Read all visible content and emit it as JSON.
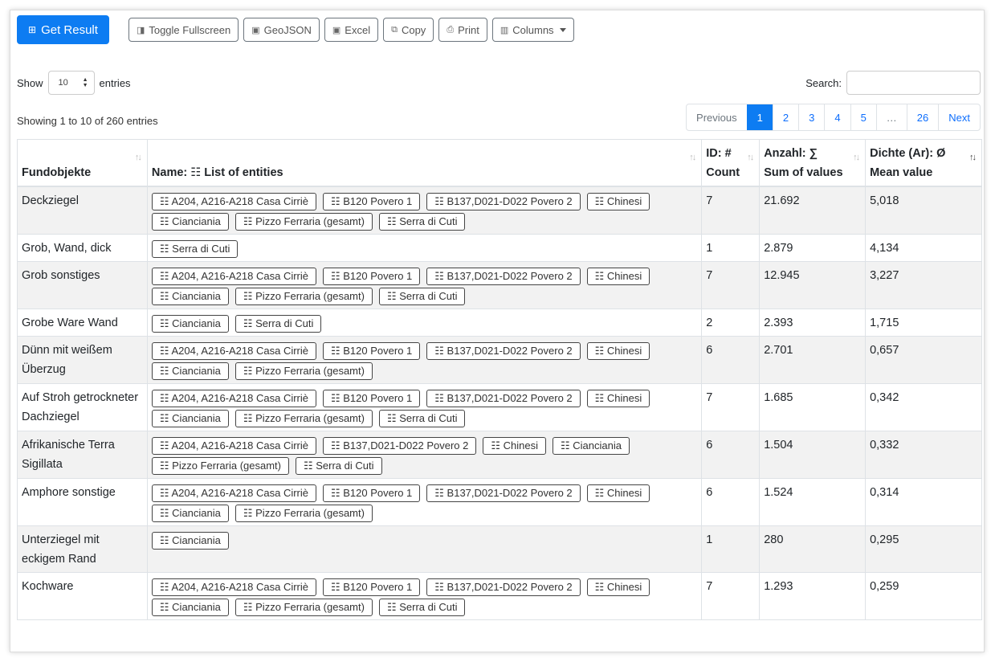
{
  "toolbar": {
    "get_result": "Get Result",
    "toggle_fullscreen": "Toggle Fullscreen",
    "geojson": "GeoJSON",
    "excel": "Excel",
    "copy": "Copy",
    "print": "Print",
    "columns": "Columns"
  },
  "length": {
    "show": "Show",
    "value": "10",
    "entries": "entries"
  },
  "search": {
    "label": "Search:"
  },
  "info": "Showing 1 to 10 of 260 entries",
  "pager": [
    "Previous",
    "1",
    "2",
    "3",
    "4",
    "5",
    "…",
    "26",
    "Next"
  ],
  "columns": {
    "c1": [
      "Fundobjekte"
    ],
    "c2": [
      "Name: ☷ List of entities"
    ],
    "c3": [
      "ID: #",
      "Count"
    ],
    "c4": [
      "Anzahl: ∑",
      "Sum of values"
    ],
    "c5": [
      "Dichte (Ar): Ø",
      "Mean value"
    ]
  },
  "rows": [
    {
      "name": "Deckziegel",
      "entities": [
        "☷ A204, A216-A218 Casa Cirriè",
        "☷ B120 Povero 1",
        "☷ B137,D021-D022 Povero 2",
        "☷ Chinesi",
        "☷ Cianciania",
        "☷ Pizzo Ferraria (gesamt)",
        "☷ Serra di Cuti"
      ],
      "count": "7",
      "sum": "21.692",
      "mean": "5,018"
    },
    {
      "name": "Grob, Wand, dick",
      "entities": [
        "☷ Serra di Cuti"
      ],
      "count": "1",
      "sum": "2.879",
      "mean": "4,134"
    },
    {
      "name": "Grob sonstiges",
      "entities": [
        "☷ A204, A216-A218 Casa Cirriè",
        "☷ B120 Povero 1",
        "☷ B137,D021-D022 Povero 2",
        "☷ Chinesi",
        "☷ Cianciania",
        "☷ Pizzo Ferraria (gesamt)",
        "☷ Serra di Cuti"
      ],
      "count": "7",
      "sum": "12.945",
      "mean": "3,227"
    },
    {
      "name": "Grobe Ware Wand",
      "entities": [
        "☷ Cianciania",
        "☷ Serra di Cuti"
      ],
      "count": "2",
      "sum": "2.393",
      "mean": "1,715"
    },
    {
      "name": "Dünn mit weißem Überzug",
      "entities": [
        "☷ A204, A216-A218 Casa Cirriè",
        "☷ B120 Povero 1",
        "☷ B137,D021-D022 Povero 2",
        "☷ Chinesi",
        "☷ Cianciania",
        "☷ Pizzo Ferraria (gesamt)"
      ],
      "count": "6",
      "sum": "2.701",
      "mean": "0,657"
    },
    {
      "name": "Auf Stroh getrockneter Dachziegel",
      "entities": [
        "☷ A204, A216-A218 Casa Cirriè",
        "☷ B120 Povero 1",
        "☷ B137,D021-D022 Povero 2",
        "☷ Chinesi",
        "☷ Cianciania",
        "☷ Pizzo Ferraria (gesamt)",
        "☷ Serra di Cuti"
      ],
      "count": "7",
      "sum": "1.685",
      "mean": "0,342"
    },
    {
      "name": "Afrikanische Terra Sigillata",
      "entities": [
        "☷ A204, A216-A218 Casa Cirriè",
        "☷ B137,D021-D022 Povero 2",
        "☷ Chinesi",
        "☷ Cianciania",
        "☷ Pizzo Ferraria (gesamt)",
        "☷ Serra di Cuti"
      ],
      "count": "6",
      "sum": "1.504",
      "mean": "0,332"
    },
    {
      "name": "Amphore sonstige",
      "entities": [
        "☷ A204, A216-A218 Casa Cirriè",
        "☷ B120 Povero 1",
        "☷ B137,D021-D022 Povero 2",
        "☷ Chinesi",
        "☷ Cianciania",
        "☷ Pizzo Ferraria (gesamt)"
      ],
      "count": "6",
      "sum": "1.524",
      "mean": "0,314"
    },
    {
      "name": "Unterziegel mit eckigem Rand",
      "entities": [
        "☷ Cianciania"
      ],
      "count": "1",
      "sum": "280",
      "mean": "0,295"
    },
    {
      "name": "Kochware",
      "entities": [
        "☷ A204, A216-A218 Casa Cirriè",
        "☷ B120 Povero 1",
        "☷ B137,D021-D022 Povero 2",
        "☷ Chinesi",
        "☷ Cianciania",
        "☷ Pizzo Ferraria (gesamt)",
        "☷ Serra di Cuti"
      ],
      "count": "7",
      "sum": "1.293",
      "mean": "0,259"
    }
  ],
  "colors": {
    "primary": "#0d7cf2",
    "stripe": "#f2f2f2",
    "link": "#0d6efd"
  },
  "icons": {
    "get_result": "grid-icon",
    "toggle_fullscreen": "fullscreen-icon",
    "geojson": "save-icon",
    "excel": "save-icon",
    "copy": "copy-icon",
    "print": "print-icon",
    "columns": "columns-icon"
  }
}
